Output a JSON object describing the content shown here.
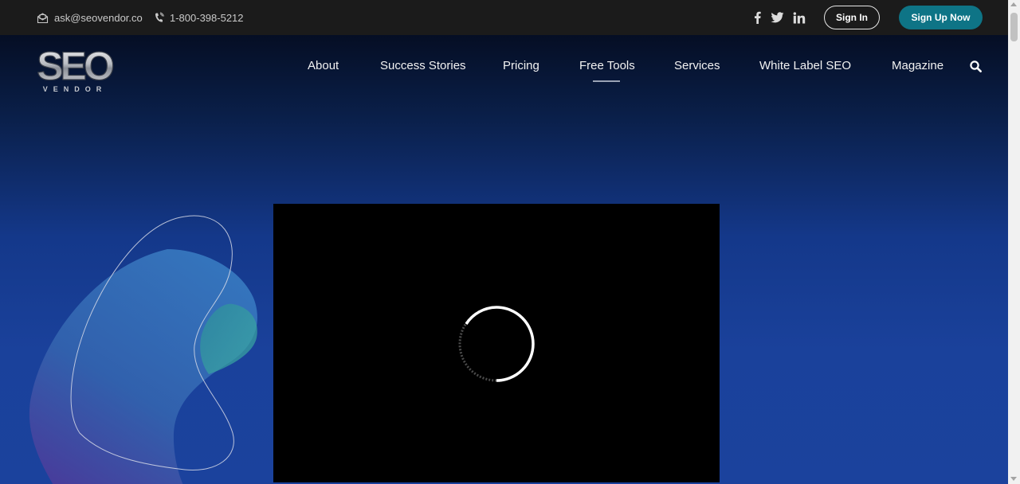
{
  "topbar": {
    "email": "ask@seovendor.co",
    "phone": "1-800-398-5212",
    "social": [
      "facebook-icon",
      "twitter-icon",
      "linkedin-icon"
    ],
    "signin_label": "Sign In",
    "signup_label": "Sign Up Now",
    "signup_color": "#0e7486"
  },
  "logo": {
    "main": "SEO",
    "sub": "VENDOR"
  },
  "nav": {
    "items": [
      "About",
      "Success Stories",
      "Pricing",
      "Free Tools",
      "Services",
      "White Label SEO",
      "Magazine"
    ],
    "active": "Free Tools",
    "search_icon": "search-icon"
  },
  "video": {
    "state": "loading",
    "icon": "loading-spinner-icon"
  }
}
